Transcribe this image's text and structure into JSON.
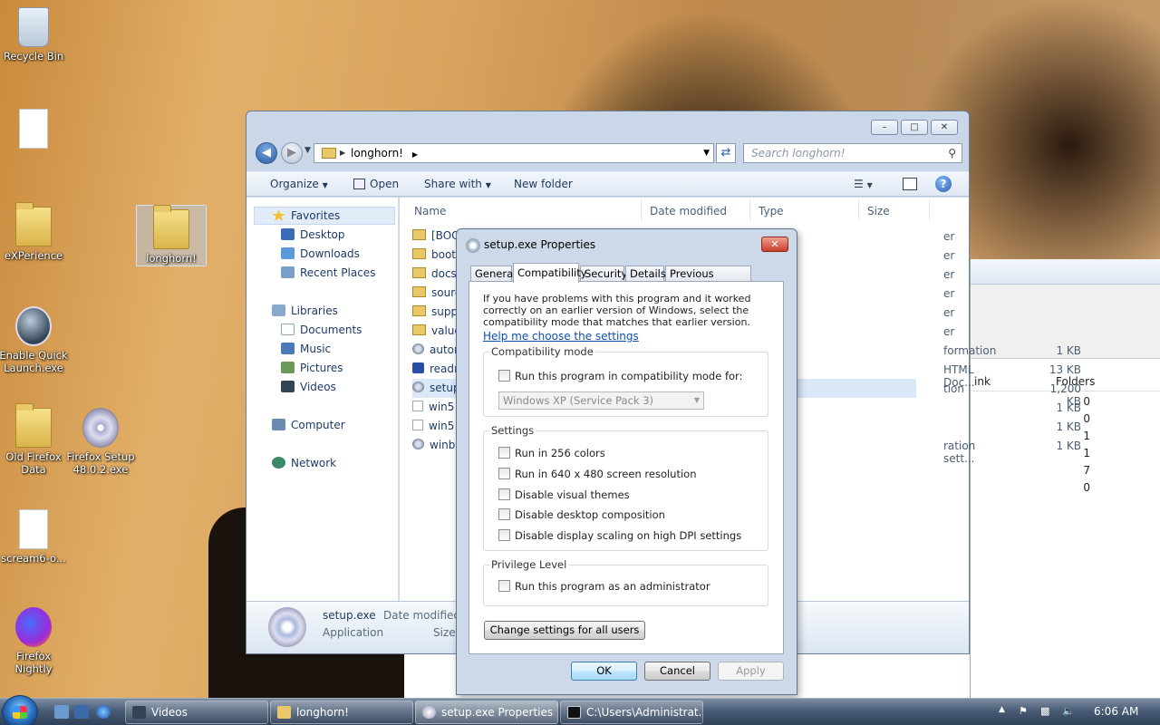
{
  "desktop": {
    "icons": [
      {
        "label": "Recycle Bin",
        "icon": "recycle-bin-icon"
      },
      {
        "label": "",
        "icon": "document-icon"
      },
      {
        "label": "eXPerience",
        "icon": "folder-icon"
      },
      {
        "label": "longhorn!",
        "icon": "folder-icon"
      },
      {
        "label": "Enable Quick Launch.exe",
        "icon": "app-icon"
      },
      {
        "label": "Old Firefox Data",
        "icon": "folder-icon"
      },
      {
        "label": "Firefox Setup 48.0.2.exe",
        "icon": "setup-icon"
      },
      {
        "label": "scream6-o...",
        "icon": "document-icon"
      },
      {
        "label": "Firefox Nightly",
        "icon": "firefox-icon"
      }
    ]
  },
  "explorer": {
    "breadcrumb": "longhorn!",
    "search_placeholder": "Search longhorn!",
    "toolbar": {
      "organize": "Organize",
      "open": "Open",
      "share_with": "Share with",
      "new_folder": "New folder"
    },
    "nav": {
      "favorites": "Favorites",
      "favorites_items": [
        "Desktop",
        "Downloads",
        "Recent Places"
      ],
      "libraries": "Libraries",
      "libraries_items": [
        "Documents",
        "Music",
        "Pictures",
        "Videos"
      ],
      "computer": "Computer",
      "network": "Network"
    },
    "columns": {
      "name": "Name",
      "date": "Date modified",
      "type": "Type",
      "size": "Size"
    },
    "files": [
      {
        "name": "[BOO",
        "type": "er",
        "size": "",
        "icon": "folder"
      },
      {
        "name": "boot",
        "type": "er",
        "size": "",
        "icon": "folder"
      },
      {
        "name": "docs",
        "type": "er",
        "size": "",
        "icon": "folder"
      },
      {
        "name": "sourc",
        "type": "er",
        "size": "",
        "icon": "folder"
      },
      {
        "name": "supp",
        "type": "er",
        "size": "",
        "icon": "folder"
      },
      {
        "name": "value",
        "type": "er",
        "size": "",
        "icon": "folder"
      },
      {
        "name": "autor",
        "type": "formation",
        "size": "1 KB",
        "icon": "gear"
      },
      {
        "name": "readr",
        "type": "HTML Doc...",
        "size": "13 KB",
        "icon": "ie"
      },
      {
        "name": "setup",
        "type": "tion",
        "size": "1,200 KB",
        "icon": "gear"
      },
      {
        "name": "win5",
        "type": "",
        "size": "1 KB",
        "icon": "doc"
      },
      {
        "name": "win5",
        "type": "",
        "size": "1 KB",
        "icon": "doc"
      },
      {
        "name": "winb",
        "type": "ration sett...",
        "size": "1 KB",
        "icon": "gear"
      }
    ],
    "details": {
      "name": "setup.exe",
      "kind": "Application",
      "date_label": "Date modified:",
      "size_label": "Size:"
    }
  },
  "background_window": {
    "col1": "ink",
    "col2": "Folders",
    "values": [
      "0",
      "0",
      "1",
      "1",
      "7",
      "0"
    ]
  },
  "dialog": {
    "title": "setup.exe Properties",
    "tabs": [
      "General",
      "Compatibility",
      "Security",
      "Details",
      "Previous Versions"
    ],
    "active_tab": "Compatibility",
    "intro": "If you have problems with this program and it worked correctly on an earlier version of Windows, select the compatibility mode that matches that earlier version.",
    "help_link": "Help me choose the settings",
    "compat_group": "Compatibility mode",
    "compat_checkbox": "Run this program in compatibility mode for:",
    "compat_select": "Windows XP (Service Pack 3)",
    "settings_group": "Settings",
    "settings": [
      "Run in 256 colors",
      "Run in 640 x 480 screen resolution",
      "Disable visual themes",
      "Disable desktop composition",
      "Disable display scaling on high DPI settings"
    ],
    "privilege_group": "Privilege Level",
    "privilege_checkbox": "Run this program as an administrator",
    "change_all_button": "Change settings for all users",
    "ok": "OK",
    "cancel": "Cancel",
    "apply": "Apply"
  },
  "taskbar": {
    "tasks": [
      "Videos",
      "longhorn!",
      "setup.exe Properties",
      "C:\\Users\\Administrat..."
    ],
    "clock": "6:06 AM"
  }
}
